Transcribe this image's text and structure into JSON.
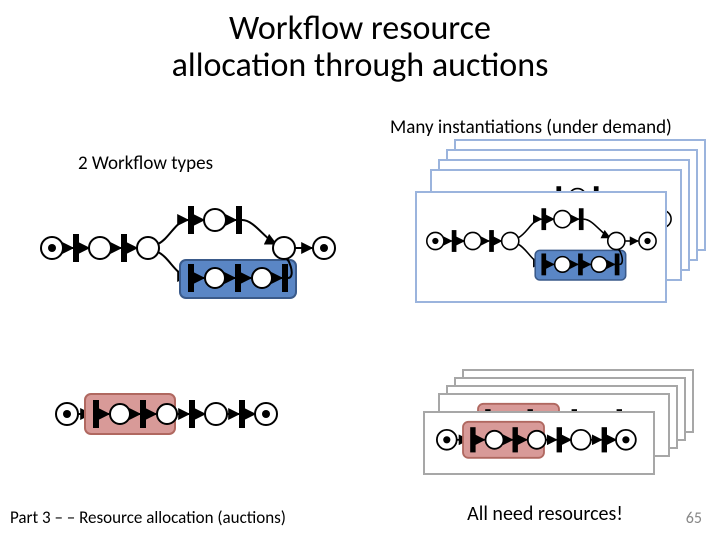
{
  "title_line1": "Workflow resource",
  "title_line2": "allocation through auctions",
  "left_heading": "2 Workflow types",
  "right_heading": "Many instantiations (under demand)",
  "footer_left": "Part 3 – – Resource allocation (auctions)",
  "footer_center": "All need resources!",
  "page_number": "65",
  "colors": {
    "blue_box": "#5a86c5",
    "red_box": "#d89a98",
    "card_stroke": "#a7a7a7"
  },
  "chart_data": {
    "type": "diagram",
    "workflow_types": [
      {
        "id": "type_a",
        "has_blue_subgroup": true,
        "nodes": [
          "start(token)",
          "trans",
          "place",
          "trans",
          "split_place",
          "branch_top:[trans, place, trans]",
          "branch_bot(blue):[trans, place, trans, place]",
          "merge_place",
          "end(token)"
        ]
      },
      {
        "id": "type_b",
        "has_red_subgroup": true,
        "nodes": [
          "start(token)",
          "red:[trans, place, trans]",
          "place",
          "trans",
          "place",
          "trans",
          "end(token)"
        ]
      }
    ],
    "instantiations": {
      "type_a_count": 5,
      "type_b_count": 5
    },
    "notes": "Petri-net style diagrams: filled vertical bars are transitions, circles are places, start/end places contain a token (small filled circle). Blue rounded box groups a sub-workflow in type A; red rounded box groups a sub-workflow in type B. Right column shows stacked copies (cards) of each type."
  }
}
